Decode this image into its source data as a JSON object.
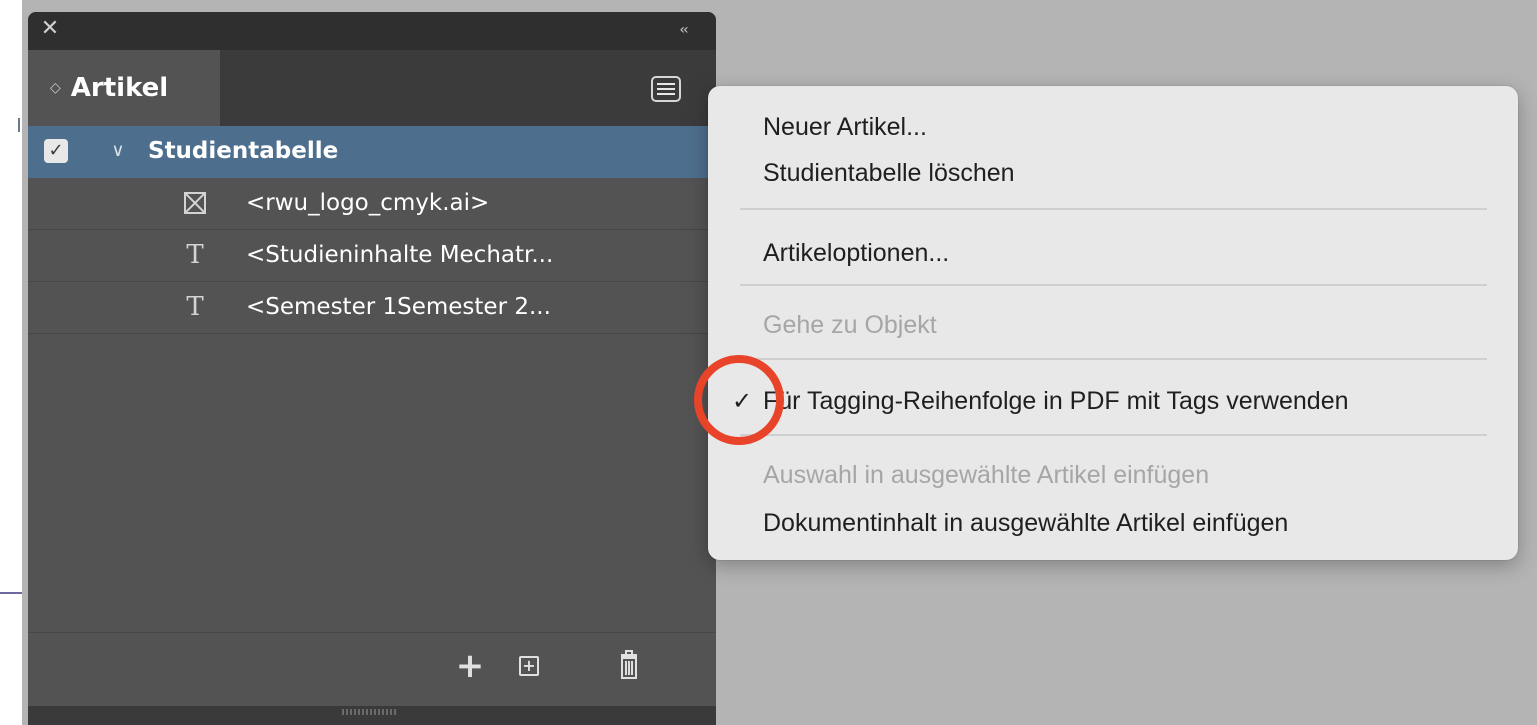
{
  "panel": {
    "close_glyph": "✕",
    "collapse_glyph": "‹‹",
    "tab_label": "Artikel",
    "tab_arrows": "◇",
    "article": {
      "title": "Studientabelle",
      "checked": true,
      "disclosure": "∨"
    },
    "items": [
      {
        "icon": "graphic-frame-icon",
        "label": "<rwu_logo_cmyk.ai>"
      },
      {
        "icon": "text-frame-icon",
        "label": "<Studieninhalte Mechatr..."
      },
      {
        "icon": "text-frame-icon",
        "label": "<Semester 1Semester 2..."
      }
    ],
    "footer": {
      "add_glyph": "+",
      "add_frame_glyph": "+"
    }
  },
  "context_menu": {
    "items": [
      {
        "label": "Neuer Artikel...",
        "enabled": true
      },
      {
        "label": "Studientabelle löschen",
        "enabled": true
      },
      {
        "label": "Artikeloptionen...",
        "enabled": true
      },
      {
        "label": "Gehe zu Objekt",
        "enabled": false
      },
      {
        "label": "Für Tagging-Reihenfolge in PDF mit Tags verwenden",
        "enabled": true,
        "checked": true,
        "checkmark": "✓"
      },
      {
        "label": "Auswahl in ausgewählte Artikel einfügen",
        "enabled": false
      },
      {
        "label": "Dokumentinhalt in ausgewählte Artikel einfügen",
        "enabled": true
      }
    ]
  },
  "colors": {
    "panel_bg": "#535353",
    "selected_row": "#4e6e8e",
    "menu_bg": "#e8e8e8",
    "highlight_ring": "#e8442a"
  }
}
